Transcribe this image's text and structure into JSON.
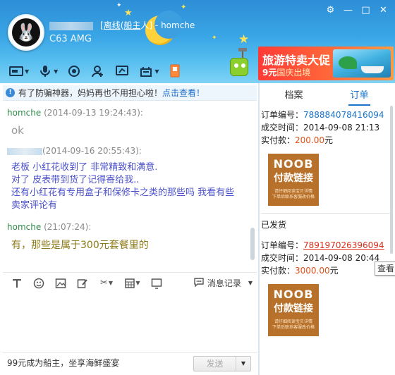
{
  "header": {
    "contact_status_open": "[",
    "contact_status_mid": "离线",
    "contact_role": "船主",
    "contact_close": "人]",
    "own_id": "homche",
    "signature": "C63 AMG"
  },
  "window_controls": [
    "settings-icon",
    "minimize-icon",
    "maximize-icon",
    "close-icon"
  ],
  "toolbar": [
    "file-transfer-icon",
    "voice-call-icon",
    "video-call-icon",
    "add-contact-icon",
    "remote-desktop-icon",
    "app-icon",
    "shop-icon"
  ],
  "ad": {
    "title": "旅游特卖大促",
    "line_prefix": "9元",
    "line_suffix": "国庆出境"
  },
  "notice": {
    "text": "有了防骗神器，妈妈再也不用担心啦！",
    "link": "点击查看！"
  },
  "messages": [
    {
      "sender": "homche",
      "time": "(2014-09-13 19:24:43):",
      "text": "ok"
    },
    {
      "sender": "",
      "time": "(2014-09-16 20:55:43):",
      "lines": [
        "老板  小红花收到了  非常精致和满意.",
        "对了  皮表带到货了记得寄给我..",
        "还有小红花有专用盒子和保修卡之类的那些吗  我看有些",
        "卖家评论有"
      ]
    },
    {
      "sender": "homche",
      "time": "(21:07:24):",
      "text": "有，那些是属于300元套餐里的"
    }
  ],
  "editbar": {
    "history_label": "消息记录"
  },
  "footer": {
    "promo": "99元成为船主，坐享海鲜盛宴",
    "send_label": "发送"
  },
  "right_tabs": [
    "档案",
    "订单"
  ],
  "orders": [
    {
      "order_label": "订单编号：",
      "order_no": "788884078416094",
      "time_label": "成交时间：",
      "time": "2014-09-08 21:13",
      "amount_label": "实付款：",
      "amount": "200.00",
      "unit": "元",
      "status": ""
    },
    {
      "order_label": "订单编号：",
      "order_no": "789197026396094",
      "time_label": "成交时间：",
      "time": "2014-09-08 20:44",
      "amount_label": "实付款：",
      "amount": "3000.00",
      "unit": "元",
      "status": "已发货"
    }
  ],
  "noob": {
    "line1": "NOOB",
    "line2": "付款链接",
    "line3": "请仔细阅读宝贝详情",
    "line4": "下单后联系客服改价格"
  },
  "tooltip": "查看"
}
